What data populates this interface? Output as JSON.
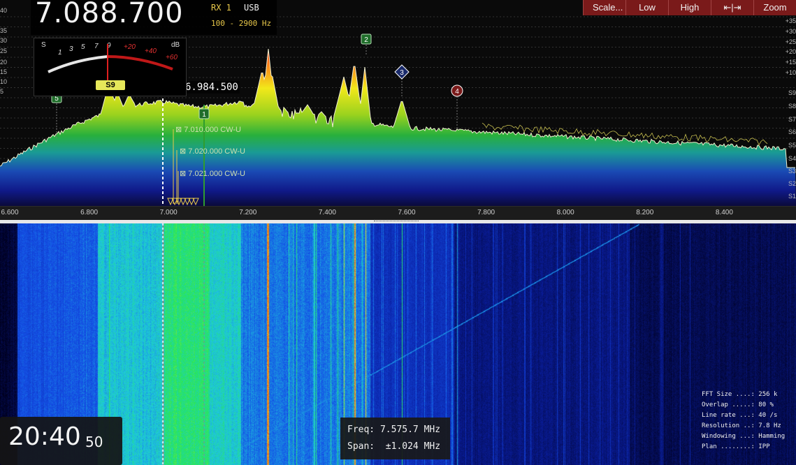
{
  "vfo": {
    "frequency": "7.088.700",
    "rx": "RX 1",
    "mode": "USB",
    "bandwidth": "100 - 2900 Hz"
  },
  "smeter": {
    "s_label": "S",
    "db_label": "dB",
    "s_scale": [
      "1",
      "3",
      "5",
      "7",
      "9"
    ],
    "db_scale": [
      "+20",
      "+40",
      "+60"
    ],
    "reading": "S9"
  },
  "toolbar": {
    "scale": "Scale...",
    "low": "Low",
    "high": "High",
    "fit": "⇤|⇥",
    "zoom": "Zoom"
  },
  "cursor_freq": "6.984.500",
  "axis": {
    "ticks": [
      "6.600",
      "6.800",
      "7.000",
      "7.200",
      "7.400",
      "7.600",
      "7.800",
      "8.000",
      "8.200",
      "8.400"
    ]
  },
  "db_scale_left": [
    "40",
    "35",
    "30",
    "25",
    "20",
    "15",
    "10",
    "5"
  ],
  "db_scale_right": [
    "+35",
    "+30",
    "+25",
    "+20",
    "+15",
    "+10",
    "S9",
    "S8",
    "S7",
    "S6",
    "S5",
    "S4",
    "S3",
    "S2",
    "S1"
  ],
  "markers": [
    "1",
    "2",
    "3",
    "4",
    "5"
  ],
  "spots": [
    "⊠ 7.010.000 CW-U",
    "⊠ 7.020.000 CW-U",
    "⊠ 7.021.000 CW-U"
  ],
  "clock": {
    "hhmm": "20:40",
    "ss": "50"
  },
  "freq_info": {
    "freq": "Freq: 7.575.7 MHz",
    "span": "Span:  ±1.024 MHz"
  },
  "fft_info": [
    "FFT Size ....: 256 k",
    "Overlap .....: 80 %",
    "Line rate ...: 40 /s",
    "Resolution ..: 7.8 Hz",
    "Windowing ...: Hamming",
    "Plan ........: IPP"
  ],
  "colors": {
    "button_bg": "#7a1a1a",
    "accent_yellow": "#e8c84a",
    "marker_green": "#2e7d32"
  }
}
